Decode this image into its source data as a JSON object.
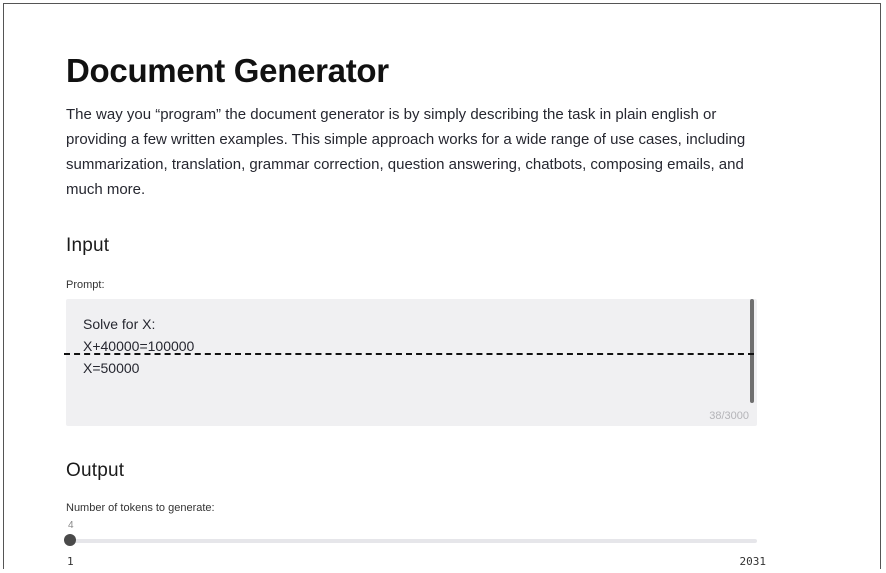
{
  "page": {
    "title": "Document Generator",
    "description": "The way you “program” the document generator is by simply describing the task in plain english or providing a few written examples. This simple approach works for a wide range of use cases, including summarization, translation, grammar correction, question answering, chatbots, composing emails, and much more."
  },
  "input_section": {
    "heading": "Input",
    "prompt_label": "Prompt:",
    "prompt_value": "Solve for X:\nX+40000=100000\nX=50000",
    "char_count": "38/3000"
  },
  "output_section": {
    "heading": "Output",
    "tokens_label": "Number of tokens to generate:",
    "slider": {
      "value": "4",
      "min": "1",
      "max": "2031"
    }
  }
}
